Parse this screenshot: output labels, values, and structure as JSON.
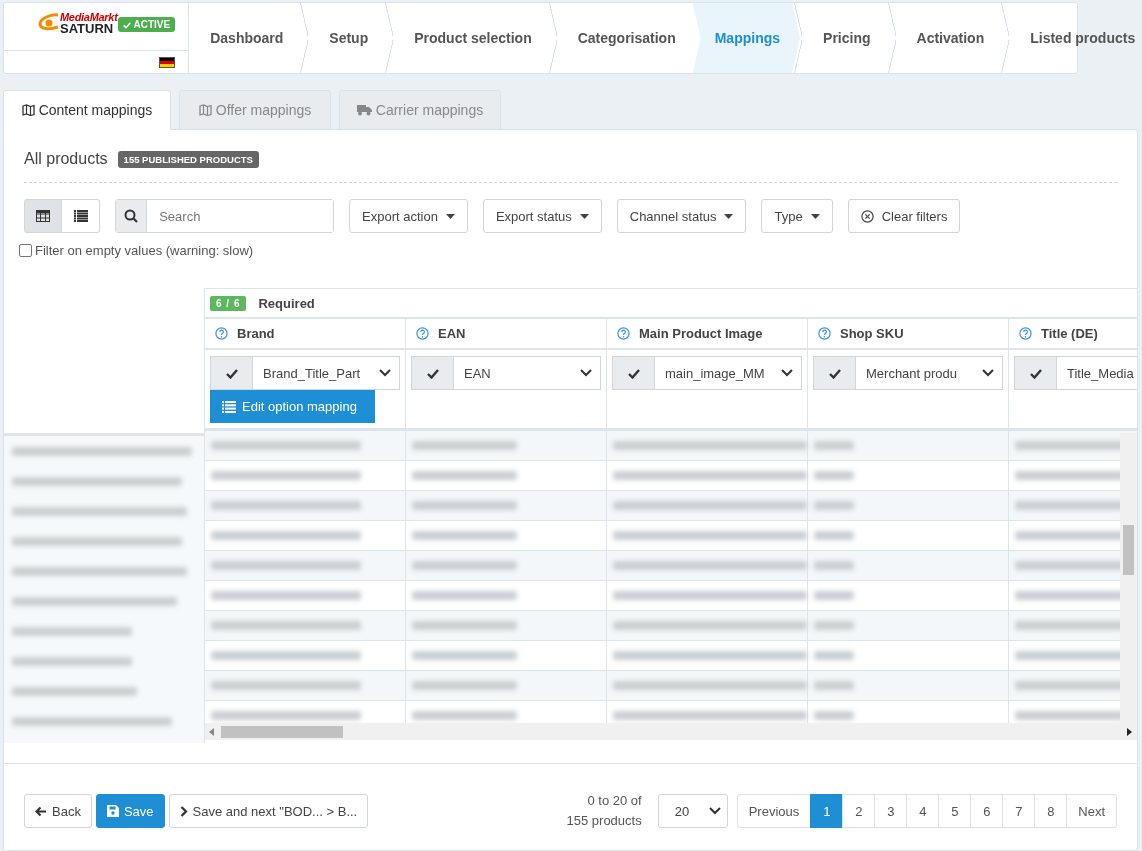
{
  "account": {
    "logo": {
      "line_1": "MediaMarkt",
      "line_2": "SATURN"
    },
    "status": "ACTIVE"
  },
  "steps": [
    {
      "label": "Dashboard",
      "selected": false
    },
    {
      "label": "Setup",
      "selected": false
    },
    {
      "label": "Product selection",
      "selected": false
    },
    {
      "label": "Categorisation",
      "selected": false
    },
    {
      "label": "Mappings",
      "selected": true
    },
    {
      "label": "Pricing",
      "selected": false
    },
    {
      "label": "Activation",
      "selected": false
    },
    {
      "label": "Listed products",
      "selected": false
    }
  ],
  "tabs": [
    {
      "label": "Content mappings",
      "kind": "map",
      "selected": true
    },
    {
      "label": "Offer mappings",
      "kind": "map",
      "selected": false
    },
    {
      "label": "Carrier mappings",
      "kind": "truck",
      "selected": false
    }
  ],
  "heading": {
    "title": "All products",
    "badge": "155 PUBLISHED PRODUCTS"
  },
  "view_toggle": [
    {
      "kind": "grid",
      "selected": true
    },
    {
      "kind": "list",
      "selected": false
    }
  ],
  "search": {
    "placeholder": "Search"
  },
  "filters": [
    {
      "label": "Export action",
      "kind": "dropdown"
    },
    {
      "label": "Export status",
      "kind": "dropdown"
    },
    {
      "label": "Channel status",
      "kind": "dropdown"
    },
    {
      "label": "Type",
      "kind": "dropdown"
    },
    {
      "label": "Clear filters",
      "kind": "clear"
    }
  ],
  "empty_filter": {
    "label": "Filter on empty values (warning: slow)",
    "checked": false
  },
  "mapping_table": {
    "group": {
      "count": "6 / 6",
      "label": "Required"
    },
    "columns": [
      {
        "name": "Brand",
        "value": "Brand_Title_Part",
        "action": "Edit option mapping"
      },
      {
        "name": "EAN",
        "value": "EAN"
      },
      {
        "name": "Main Product Image",
        "value": "main_image_MM"
      },
      {
        "name": "Shop SKU",
        "value": "Merchant produ"
      },
      {
        "name": "Title (DE)",
        "value": "Title_Media"
      }
    ],
    "rows": [
      {
        "kind": "redacted"
      },
      {
        "kind": "redacted"
      },
      {
        "kind": "redacted"
      },
      {
        "kind": "redacted"
      },
      {
        "kind": "redacted"
      },
      {
        "kind": "redacted"
      },
      {
        "kind": "redacted"
      },
      {
        "kind": "redacted"
      },
      {
        "kind": "redacted"
      },
      {
        "kind": "redacted"
      }
    ]
  },
  "footer": {
    "buttons": [
      {
        "label": "Back",
        "kind": "back"
      },
      {
        "label": "Save",
        "kind": "primary"
      },
      {
        "label": "Save and next \"BOD... > B...",
        "kind": "next"
      }
    ],
    "range": "0 to 20 of 155 products",
    "page_size": "20",
    "pagination": [
      {
        "label": "Previous",
        "selected": false
      },
      {
        "label": "1",
        "selected": true
      },
      {
        "label": "2",
        "selected": false
      },
      {
        "label": "3",
        "selected": false
      },
      {
        "label": "4",
        "selected": false
      },
      {
        "label": "5",
        "selected": false
      },
      {
        "label": "6",
        "selected": false
      },
      {
        "label": "7",
        "selected": false
      },
      {
        "label": "8",
        "selected": false
      },
      {
        "label": "Next",
        "selected": false
      }
    ]
  }
}
